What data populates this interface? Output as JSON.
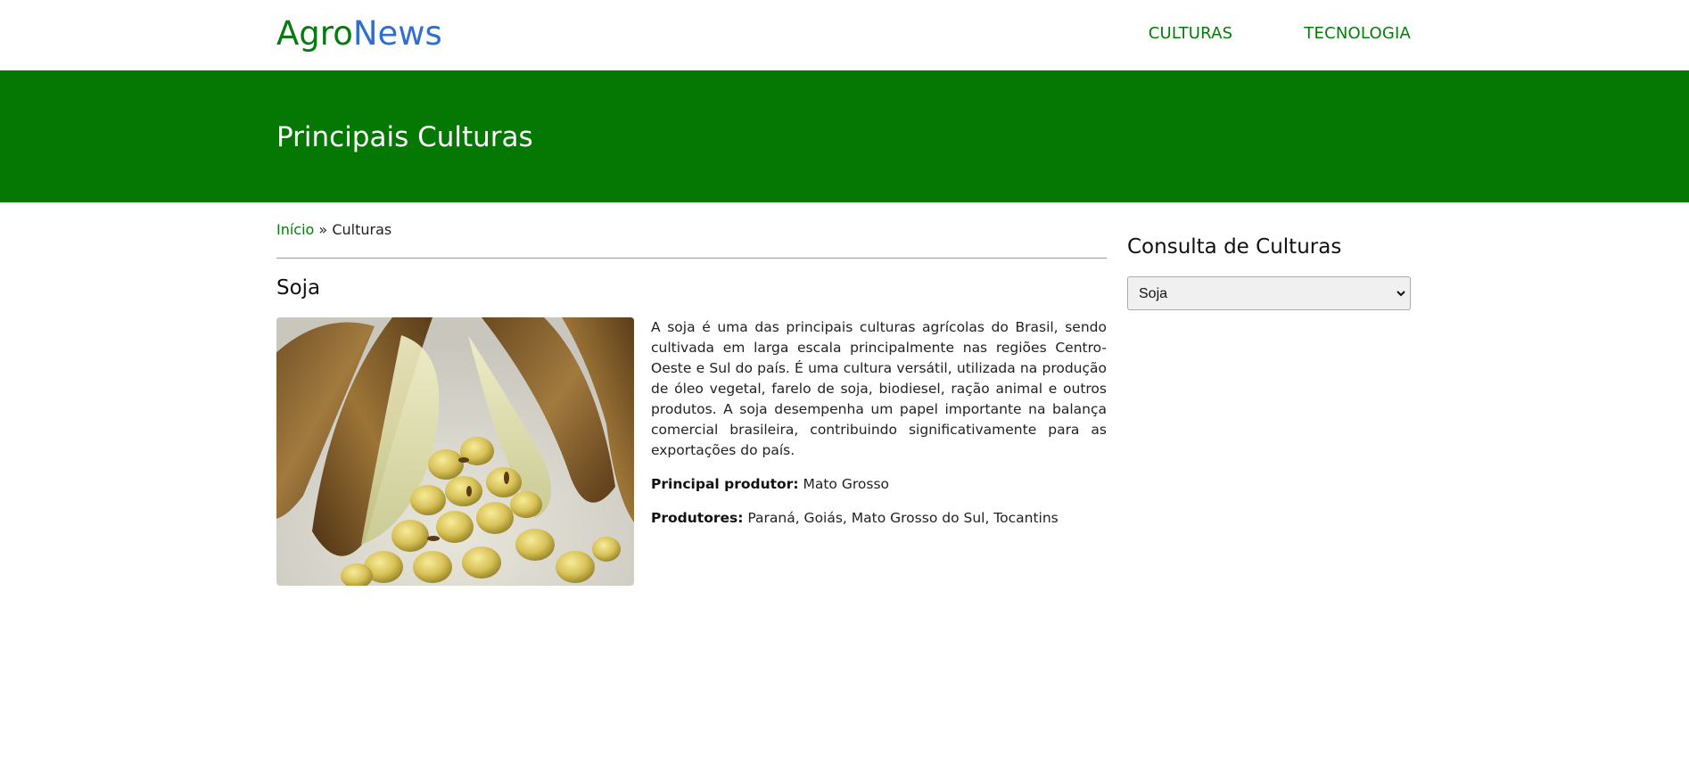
{
  "brand": {
    "part1": "Agro",
    "part2": "News"
  },
  "nav": {
    "items": [
      {
        "label": "CULTURAS"
      },
      {
        "label": "TECNOLOGIA"
      }
    ]
  },
  "banner": {
    "title": "Principais Culturas"
  },
  "breadcrumb": {
    "home": "Início",
    "separator": " » ",
    "current": "Culturas"
  },
  "crop": {
    "title": "Soja",
    "description": "A soja é uma das principais culturas agrícolas do Brasil, sendo cultivada em larga escala principalmente nas regiões Centro-Oeste e Sul do país. É uma cultura versátil, utilizada na produção de óleo vegetal, farelo de soja, biodiesel, ração animal e outros produtos. A soja desempenha um papel importante na balança comercial brasileira, contribuindo significativamente para as exportações do país.",
    "main_producer_label": "Principal produtor:",
    "main_producer": "Mato Grosso",
    "producers_label": "Produtores:",
    "producers": "Paraná, Goiás, Mato Grosso do Sul, Tocantins"
  },
  "sidebar": {
    "title": "Consulta de Culturas",
    "select_value": "Soja"
  },
  "colors": {
    "brand_green": "#087b10",
    "brand_blue": "#2f6fd2",
    "banner_green": "#047803"
  },
  "icons": {
    "dropdown": "chevron-down-icon"
  }
}
